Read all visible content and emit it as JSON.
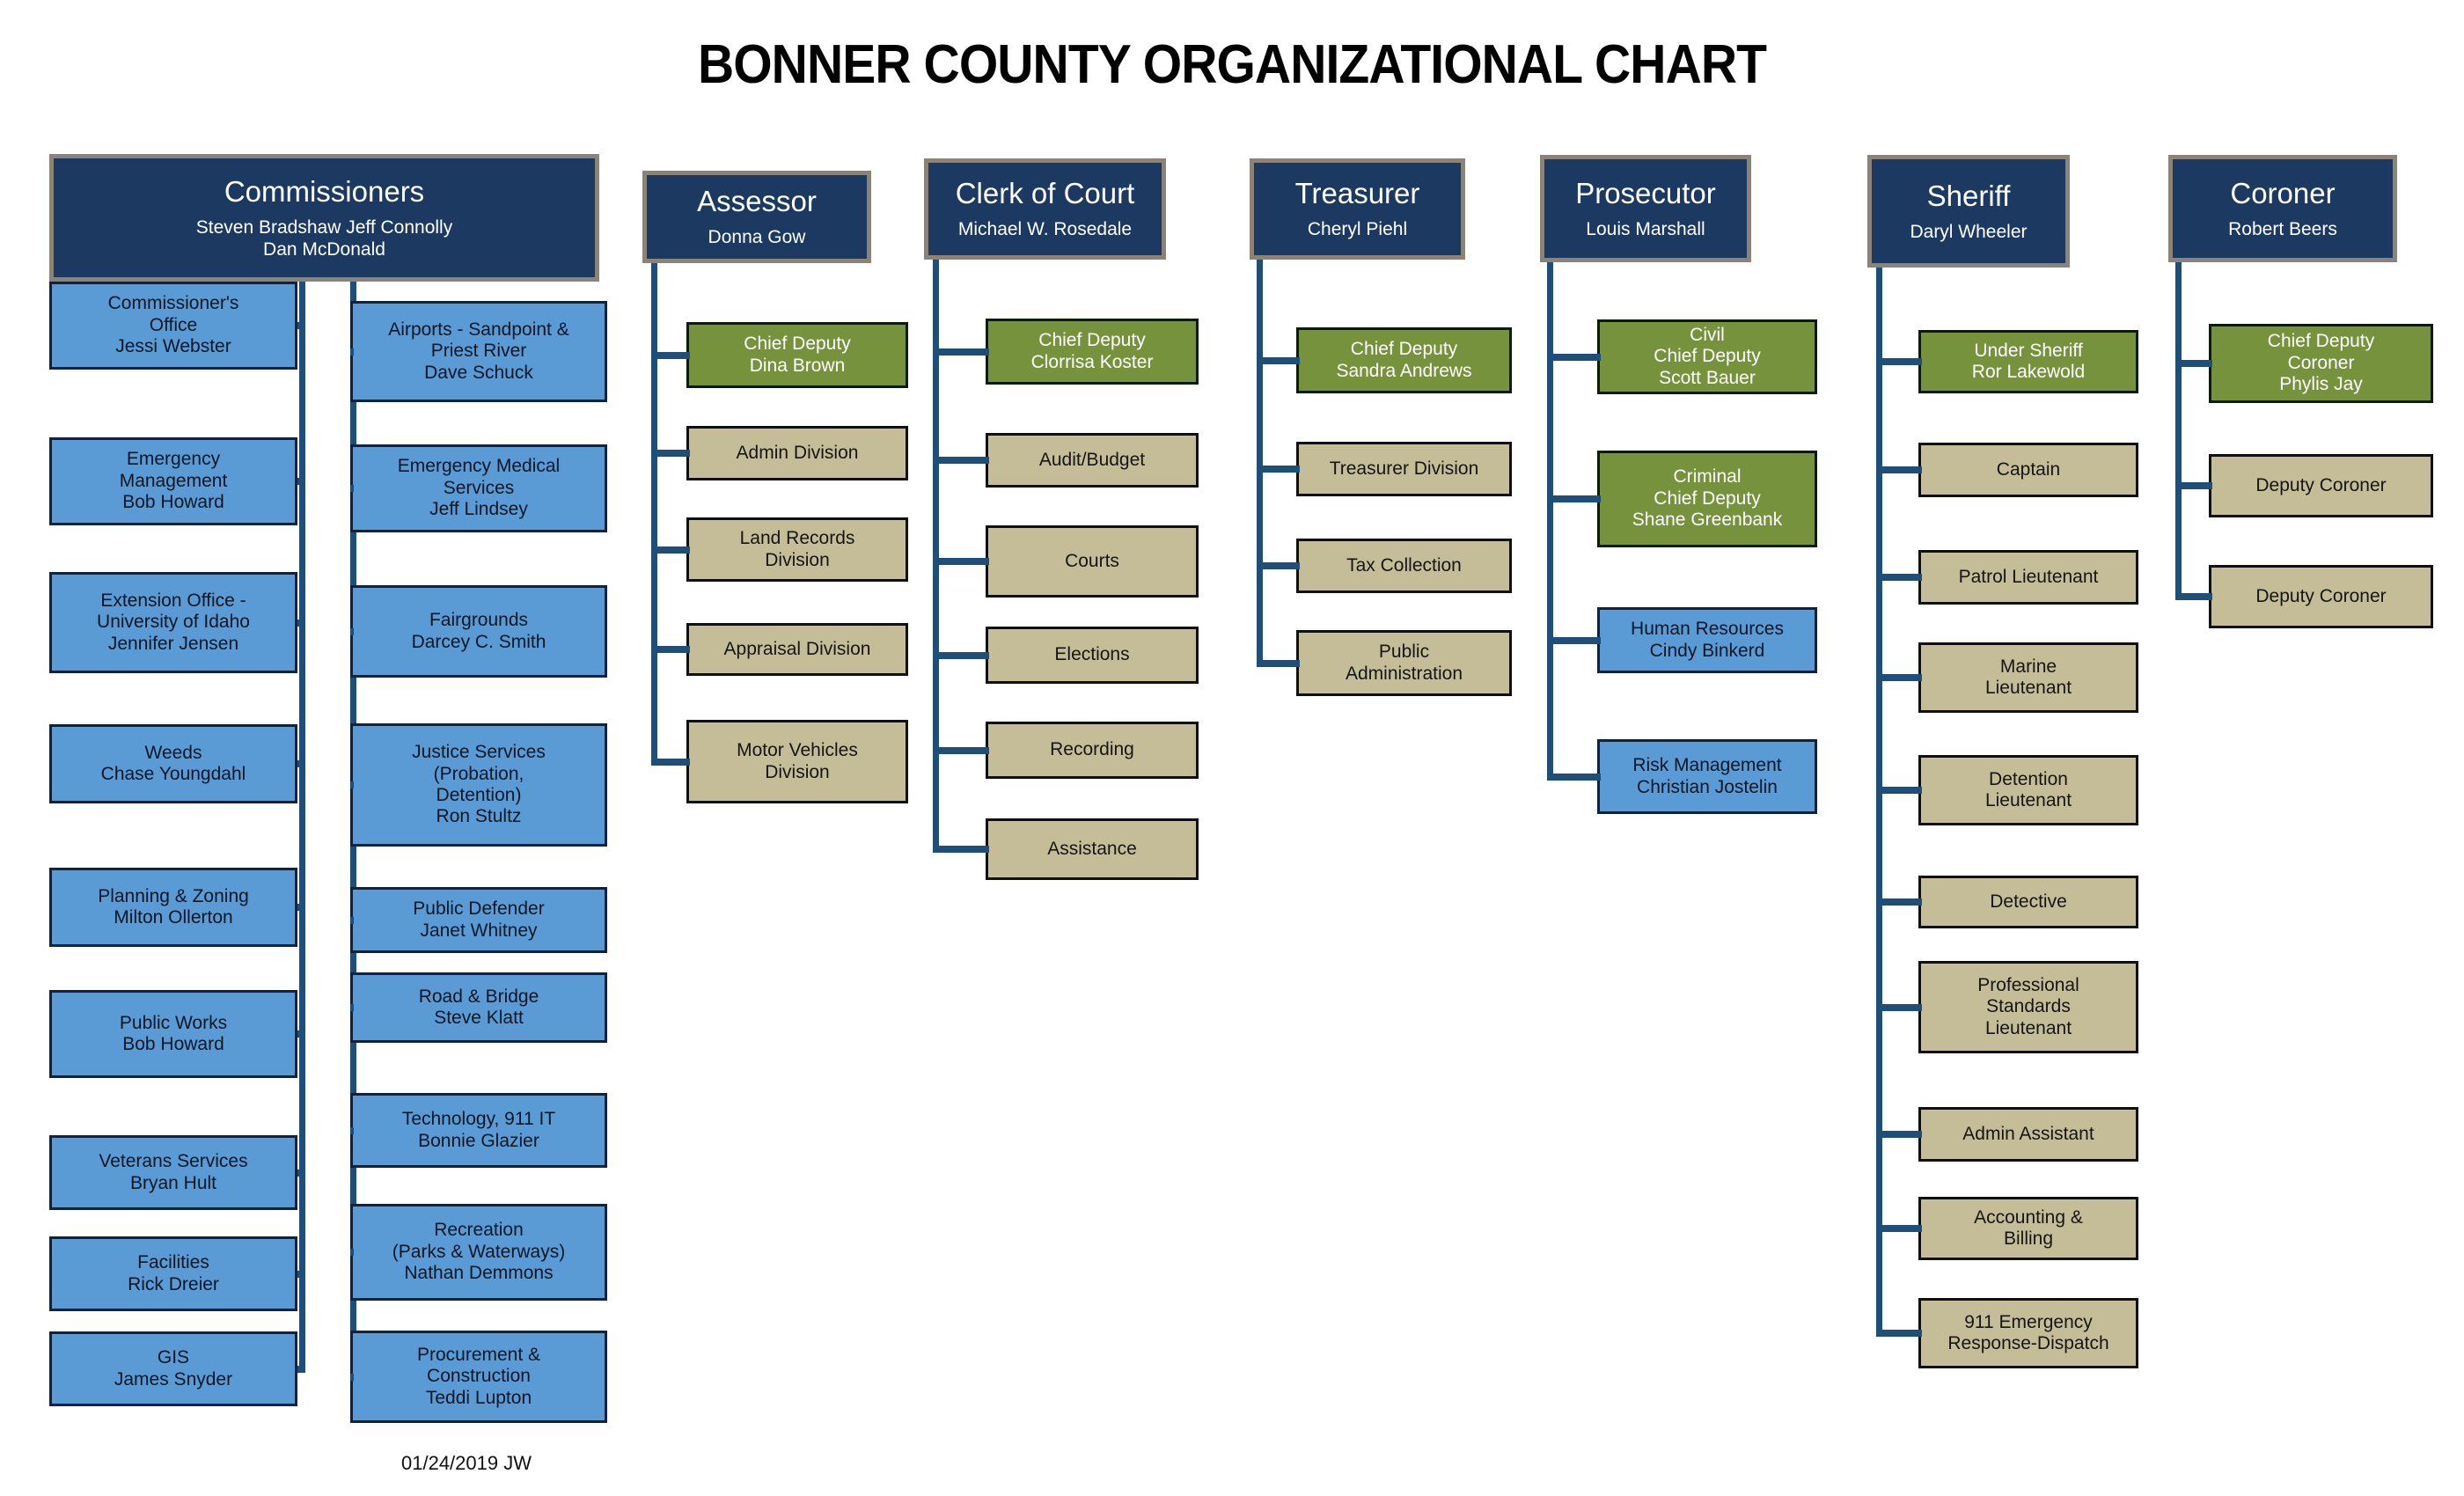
{
  "title": "BONNER COUNTY ORGANIZATIONAL CHART",
  "footer": {
    "date_initials": "01/24/2019 JW"
  },
  "colors": {
    "header_fill": "#1c3a61",
    "header_border": "#8b8378",
    "blue_box": "#5b9bd5",
    "green_box": "#77923c",
    "tan_box": "#c5bd97",
    "connector": "#1f4e79",
    "text_dark": "#0c1726",
    "text_light": "#ffffff"
  },
  "departments": [
    {
      "id": "commissioners",
      "header": {
        "title": "Commissioners",
        "names": "Steven Bradshaw   Jeff Connolly\nDan McDonald"
      },
      "left_children": [
        {
          "lines": [
            "Commissioner's",
            "Office",
            "Jessi Webster"
          ],
          "style": "blue"
        },
        {
          "lines": [
            "Emergency",
            "Management",
            "Bob Howard"
          ],
          "style": "blue"
        },
        {
          "lines": [
            "Extension Office -",
            "University of Idaho",
            "Jennifer Jensen"
          ],
          "style": "blue"
        },
        {
          "lines": [
            "Weeds",
            "Chase Youngdahl"
          ],
          "style": "blue"
        },
        {
          "lines": [
            "Planning & Zoning",
            "Milton Ollerton"
          ],
          "style": "blue"
        },
        {
          "lines": [
            "Public Works",
            "Bob Howard"
          ],
          "style": "blue"
        },
        {
          "lines": [
            "Veterans Services",
            "Bryan Hult"
          ],
          "style": "blue"
        },
        {
          "lines": [
            "Facilities",
            "Rick Dreier"
          ],
          "style": "blue"
        },
        {
          "lines": [
            "GIS",
            "James Snyder"
          ],
          "style": "blue"
        }
      ],
      "right_children": [
        {
          "lines": [
            "Airports - Sandpoint &",
            "Priest River",
            "Dave Schuck"
          ],
          "style": "blue"
        },
        {
          "lines": [
            "Emergency Medical",
            "Services",
            "Jeff Lindsey"
          ],
          "style": "blue"
        },
        {
          "lines": [
            "Fairgrounds",
            "Darcey C. Smith"
          ],
          "style": "blue"
        },
        {
          "lines": [
            "Justice Services",
            "(Probation,",
            "Detention)",
            "Ron Stultz"
          ],
          "style": "blue"
        },
        {
          "lines": [
            "Public Defender",
            "Janet Whitney"
          ],
          "style": "blue"
        },
        {
          "lines": [
            "Road & Bridge",
            "Steve Klatt"
          ],
          "style": "blue"
        },
        {
          "lines": [
            "Technology, 911 IT",
            "Bonnie Glazier"
          ],
          "style": "blue"
        },
        {
          "lines": [
            "Recreation",
            "(Parks & Waterways)",
            "Nathan Demmons"
          ],
          "style": "blue"
        },
        {
          "lines": [
            "Procurement &",
            "Construction",
            "Teddi Lupton"
          ],
          "style": "blue"
        }
      ]
    },
    {
      "id": "assessor",
      "header": {
        "title": "Assessor",
        "names": "Donna Gow"
      },
      "children": [
        {
          "lines": [
            "Chief  Deputy",
            "Dina Brown"
          ],
          "style": "green"
        },
        {
          "lines": [
            "Admin Division"
          ],
          "style": "tan"
        },
        {
          "lines": [
            "Land Records",
            "Division"
          ],
          "style": "tan"
        },
        {
          "lines": [
            "Appraisal Division"
          ],
          "style": "tan"
        },
        {
          "lines": [
            "Motor Vehicles",
            "Division"
          ],
          "style": "tan"
        }
      ]
    },
    {
      "id": "clerk-of-court",
      "header": {
        "title": "Clerk of Court",
        "names": "Michael W. Rosedale"
      },
      "children": [
        {
          "lines": [
            "Chief  Deputy",
            "Clorrisa Koster"
          ],
          "style": "green"
        },
        {
          "lines": [
            "Audit/Budget"
          ],
          "style": "tan"
        },
        {
          "lines": [
            "Courts"
          ],
          "style": "tan"
        },
        {
          "lines": [
            "Elections"
          ],
          "style": "tan"
        },
        {
          "lines": [
            "Recording"
          ],
          "style": "tan"
        },
        {
          "lines": [
            "Assistance"
          ],
          "style": "tan"
        }
      ]
    },
    {
      "id": "treasurer",
      "header": {
        "title": "Treasurer",
        "names": "Cheryl Piehl"
      },
      "children": [
        {
          "lines": [
            "Chief  Deputy",
            "Sandra Andrews"
          ],
          "style": "green"
        },
        {
          "lines": [
            "Treasurer Division"
          ],
          "style": "tan"
        },
        {
          "lines": [
            "Tax Collection"
          ],
          "style": "tan"
        },
        {
          "lines": [
            "Public",
            "Administration"
          ],
          "style": "tan"
        }
      ]
    },
    {
      "id": "prosecutor",
      "header": {
        "title": "Prosecutor",
        "names": "Louis Marshall"
      },
      "children": [
        {
          "lines": [
            "Civil",
            "Chief Deputy",
            "Scott Bauer"
          ],
          "style": "green"
        },
        {
          "lines": [
            "Criminal",
            "Chief Deputy",
            "Shane Greenbank"
          ],
          "style": "green"
        },
        {
          "lines": [
            "Human Resources",
            "Cindy Binkerd"
          ],
          "style": "blue"
        },
        {
          "lines": [
            "Risk Management",
            "Christian Jostelin"
          ],
          "style": "blue"
        }
      ]
    },
    {
      "id": "sheriff",
      "header": {
        "title": "Sheriff",
        "names": "Daryl Wheeler"
      },
      "children": [
        {
          "lines": [
            "Under Sheriff",
            "Ror Lakewold"
          ],
          "style": "green"
        },
        {
          "lines": [
            "Captain"
          ],
          "style": "tan"
        },
        {
          "lines": [
            "Patrol Lieutenant"
          ],
          "style": "tan"
        },
        {
          "lines": [
            "Marine",
            "Lieutenant"
          ],
          "style": "tan"
        },
        {
          "lines": [
            "Detention",
            "Lieutenant"
          ],
          "style": "tan"
        },
        {
          "lines": [
            "Detective"
          ],
          "style": "tan"
        },
        {
          "lines": [
            "Professional",
            "Standards",
            "Lieutenant"
          ],
          "style": "tan"
        },
        {
          "lines": [
            "Admin Assistant"
          ],
          "style": "tan"
        },
        {
          "lines": [
            "Accounting &",
            "Billing"
          ],
          "style": "tan"
        },
        {
          "lines": [
            "911 Emergency",
            "Response-Dispatch"
          ],
          "style": "tan"
        }
      ]
    },
    {
      "id": "coroner",
      "header": {
        "title": "Coroner",
        "names": "Robert Beers"
      },
      "children": [
        {
          "lines": [
            "Chief Deputy",
            "Coroner",
            "Phylis Jay"
          ],
          "style": "green"
        },
        {
          "lines": [
            "Deputy Coroner"
          ],
          "style": "tan"
        },
        {
          "lines": [
            "Deputy Coroner"
          ],
          "style": "tan"
        }
      ]
    }
  ]
}
